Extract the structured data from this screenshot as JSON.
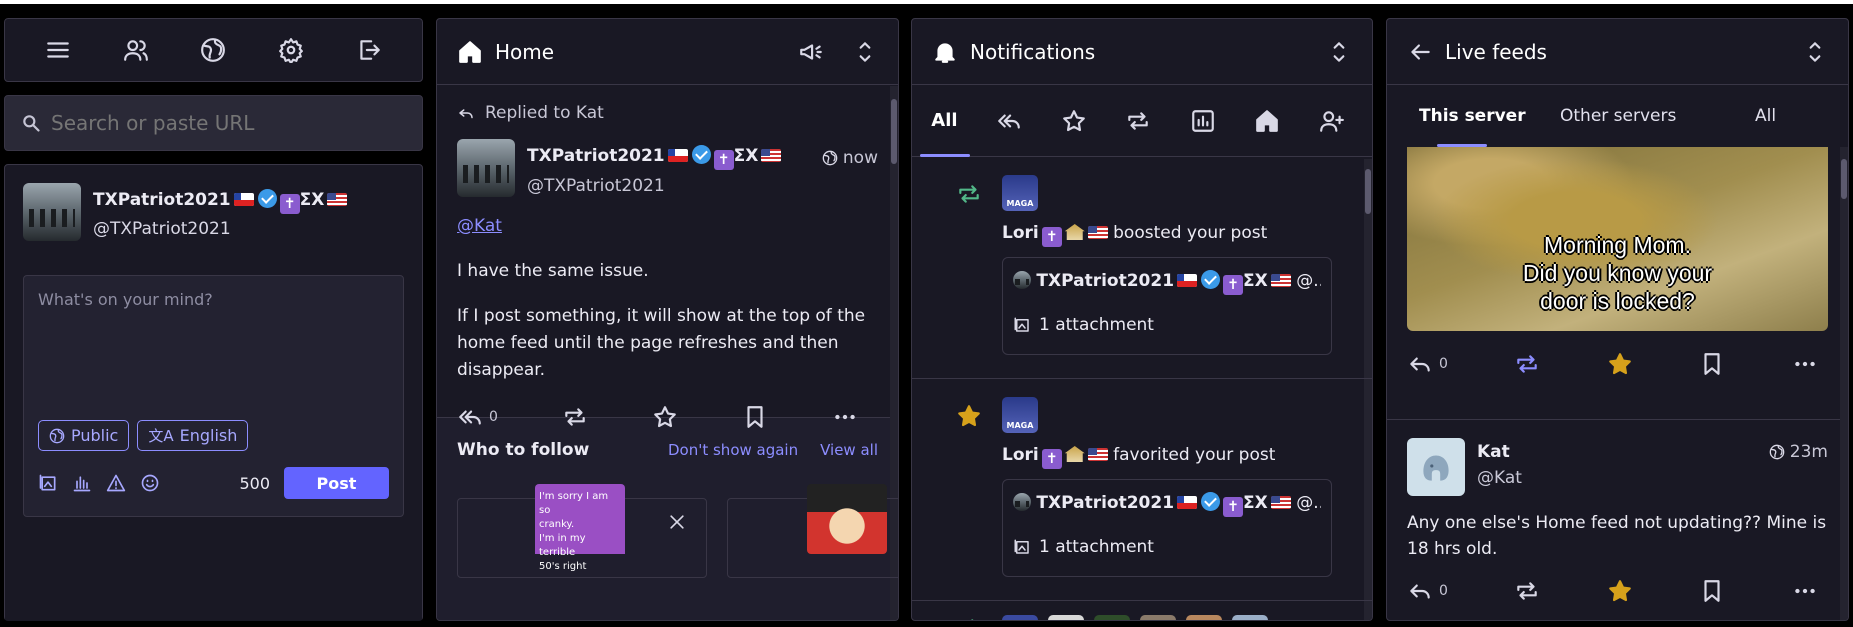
{
  "colors": {
    "accent": "#6364ff",
    "bg": "#191824",
    "star": "#d6a11b",
    "boost": "#52b788"
  },
  "col1": {
    "nav_icons": [
      "menu-icon",
      "people-icon",
      "globe-icon",
      "gear-icon",
      "logout-icon"
    ],
    "search": {
      "placeholder": "Search or paste URL"
    },
    "profile": {
      "name": "TXPatriot2021",
      "badges": "ΣΧ",
      "handle": "@TXPatriot2021"
    },
    "compose": {
      "placeholder": "What's on your mind?",
      "visibility": "Public",
      "language": "English",
      "counter": "500",
      "post_label": "Post"
    }
  },
  "col2": {
    "title": "Home",
    "replied_to": "Replied to Kat",
    "post": {
      "name": "TXPatriot2021",
      "badges": "ΣΧ",
      "handle": "@TXPatriot2021",
      "time": "now",
      "mention": "@Kat",
      "p1": "I have the same issue.",
      "p2": "If I post something, it will show at the top of the home feed until the page refreshes and then disappear.",
      "replies": "0"
    },
    "who_to_follow": {
      "title": "Who to follow",
      "dismiss": "Don't show again",
      "view_all": "View all",
      "card_text": [
        "I'm sorry I am so",
        "cranky.",
        "I'm in my terrible",
        "50's right"
      ]
    }
  },
  "col3": {
    "title": "Notifications",
    "tabs": {
      "all": "All"
    },
    "items": [
      {
        "name": "Lori",
        "action": "boosted your post",
        "post_name": "TXPatriot2021",
        "post_badges": "ΣΧ",
        "post_tail": "@...",
        "attachment": "1 attachment"
      },
      {
        "name": "Lori",
        "action": "favorited your post",
        "post_name": "TXPatriot2021",
        "post_badges": "ΣΧ",
        "post_tail": "@...",
        "attachment": "1 attachment"
      }
    ],
    "avatar_text": "MAGA"
  },
  "col4": {
    "title": "Live feeds",
    "tabs": [
      "This server",
      "Other servers",
      "All"
    ],
    "image_caption": [
      "Morning Mom.",
      "Did you know your",
      "door is locked?"
    ],
    "post1": {
      "replies": "0"
    },
    "post2": {
      "name": "Kat",
      "handle": "@Kat",
      "time": "23m",
      "text": "Any one else's Home feed not updating?? Mine is 18 hrs old.",
      "replies": "0"
    }
  }
}
